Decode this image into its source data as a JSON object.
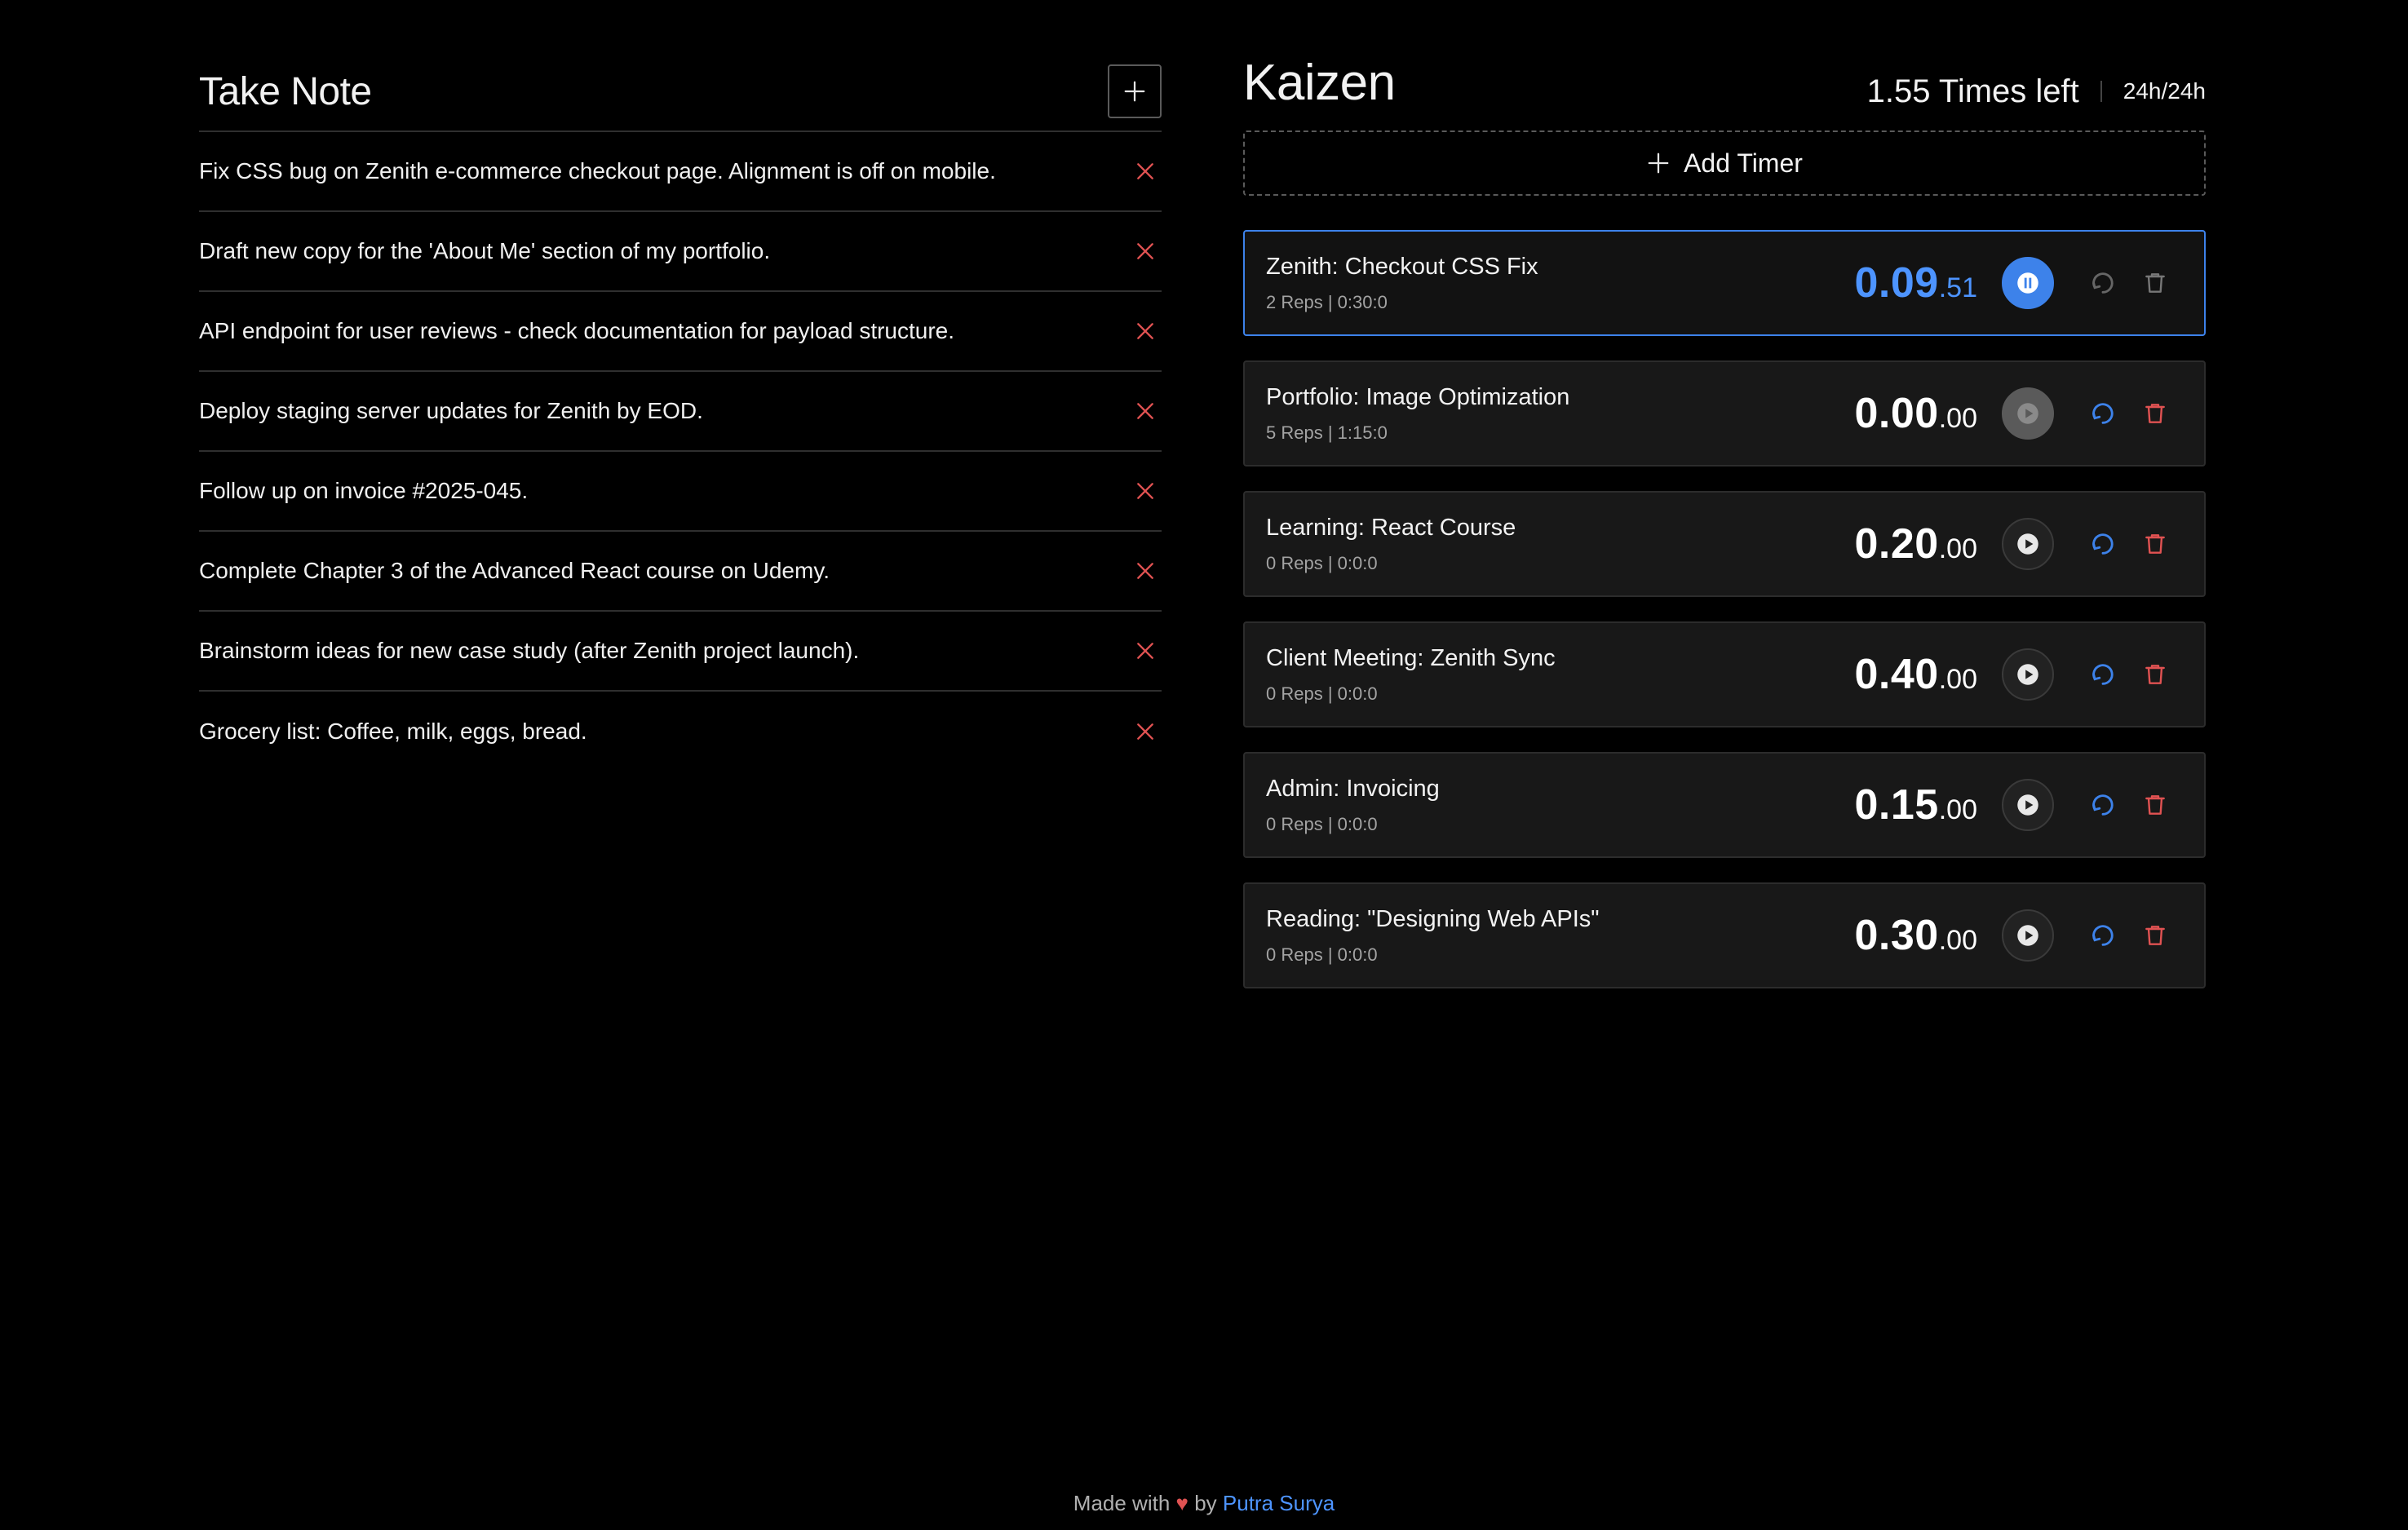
{
  "notes": {
    "title": "Take Note",
    "items": [
      {
        "text": "Fix CSS bug on Zenith e-commerce checkout page. Alignment is off on mobile."
      },
      {
        "text": "Draft new copy for the 'About Me' section of my portfolio."
      },
      {
        "text": "API endpoint for user reviews - check documentation for payload structure."
      },
      {
        "text": "Deploy staging server updates for Zenith by EOD."
      },
      {
        "text": "Follow up on invoice #2025-045."
      },
      {
        "text": "Complete Chapter 3 of the Advanced React course on Udemy."
      },
      {
        "text": "Brainstorm ideas for new case study (after Zenith project launch)."
      },
      {
        "text": "Grocery list: Coffee, milk, eggs, bread."
      }
    ]
  },
  "kaizen": {
    "title": "Kaizen",
    "times_left": "1.55 Times left",
    "hours": "24h/24h",
    "add_timer_label": "Add Timer",
    "timers": [
      {
        "name": "Zenith: Checkout CSS Fix",
        "meta": "2 Reps | 0:30:0",
        "main": "0.09",
        "sub": ".51",
        "state": "running"
      },
      {
        "name": "Portfolio: Image Optimization",
        "meta": "5 Reps | 1:15:0",
        "main": "0.00",
        "sub": ".00",
        "state": "disabled"
      },
      {
        "name": "Learning: React Course",
        "meta": "0 Reps | 0:0:0",
        "main": "0.20",
        "sub": ".00",
        "state": "idle"
      },
      {
        "name": "Client Meeting: Zenith Sync",
        "meta": "0 Reps | 0:0:0",
        "main": "0.40",
        "sub": ".00",
        "state": "idle"
      },
      {
        "name": "Admin: Invoicing",
        "meta": "0 Reps | 0:0:0",
        "main": "0.15",
        "sub": ".00",
        "state": "idle"
      },
      {
        "name": "Reading: \"Designing Web APIs\"",
        "meta": "0 Reps | 0:0:0",
        "main": "0.30",
        "sub": ".00",
        "state": "idle"
      }
    ]
  },
  "footer": {
    "made_with": "Made with",
    "heart": "♥",
    "by": "by",
    "author": "Putra Surya"
  },
  "colors": {
    "accent": "#3d82ea",
    "danger": "#e05252",
    "background": "#000000",
    "card": "#181818"
  }
}
